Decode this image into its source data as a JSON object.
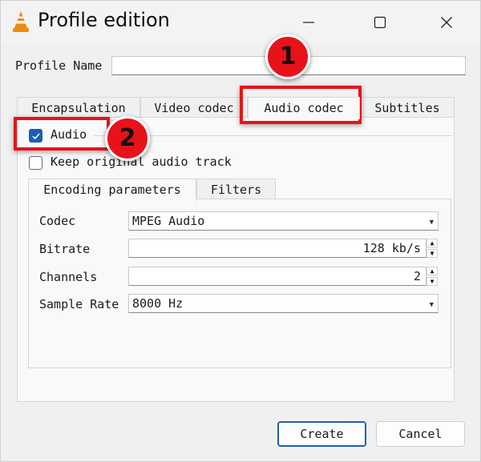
{
  "window": {
    "title": "Profile edition",
    "icon": "vlc-cone-icon"
  },
  "profile": {
    "label": "Profile Name",
    "value": "",
    "placeholder": ""
  },
  "tabs": [
    {
      "label": "Encapsulation",
      "active": false
    },
    {
      "label": "Video codec",
      "active": false
    },
    {
      "label": "Audio codec",
      "active": true
    },
    {
      "label": "Subtitles",
      "active": false
    }
  ],
  "audio": {
    "enable_label": "Audio",
    "enabled": true,
    "keep_original_label": "Keep original audio track",
    "keep_original": false
  },
  "inner_tabs": [
    {
      "label": "Encoding parameters",
      "active": true
    },
    {
      "label": "Filters",
      "active": false
    }
  ],
  "fields": {
    "codec": {
      "label": "Codec",
      "value": "MPEG Audio"
    },
    "bitrate": {
      "label": "Bitrate",
      "value": "128 kb/s"
    },
    "channels": {
      "label": "Channels",
      "value": "2"
    },
    "sample_rate": {
      "label": "Sample Rate",
      "value": "8000 Hz"
    }
  },
  "buttons": {
    "create": "Create",
    "cancel": "Cancel"
  },
  "annotations": [
    "1",
    "2"
  ],
  "colors": {
    "accent": "#1a5fb4",
    "annotation": "#e8121a",
    "vlc_orange": "#f08a10"
  }
}
